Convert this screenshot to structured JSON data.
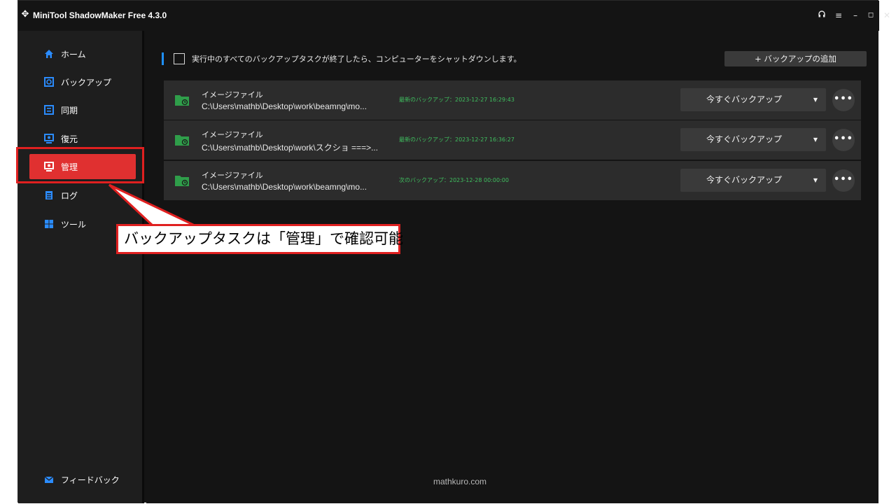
{
  "window": {
    "title": "MiniTool ShadowMaker Free 4.3.0",
    "controls": [
      "headset-icon",
      "menu-icon",
      "minimize-icon",
      "maximize-icon",
      "close-icon"
    ]
  },
  "sidebar": {
    "items": [
      {
        "label": "ホーム",
        "icon": "home-icon",
        "active": false
      },
      {
        "label": "バックアップ",
        "icon": "backup-icon",
        "active": false
      },
      {
        "label": "同期",
        "icon": "sync-icon",
        "active": false
      },
      {
        "label": "復元",
        "icon": "restore-icon",
        "active": false
      },
      {
        "label": "管理",
        "icon": "manage-icon",
        "active": true
      },
      {
        "label": "ログ",
        "icon": "log-icon",
        "active": false
      },
      {
        "label": "ツール",
        "icon": "tools-icon",
        "active": false
      }
    ],
    "feedback_label": "フィードバック"
  },
  "main": {
    "shutdown_label": "実行中のすべてのバックアップタスクが終了したら、コンピューターをシャットダウンします。",
    "add_backup_label": "+ バックアップの追加",
    "tasks": [
      {
        "name": "イメージファイル",
        "path": "C:\\Users\\mathb\\Desktop\\work\\beamng\\mo...",
        "status": "最新のバックアップ：2023-12-27 16:29:43",
        "button": "今すぐバックアップ"
      },
      {
        "name": "イメージファイル",
        "path": "C:\\Users\\mathb\\Desktop\\work\\スクショ ===>...",
        "status": "最新のバックアップ：2023-12-27 16:36:27",
        "button": "今すぐバックアップ"
      },
      {
        "name": "イメージファイル",
        "path": "C:\\Users\\mathb\\Desktop\\work\\beamng\\mo...",
        "status": "次のバックアップ：2023-12-28 00:00:00",
        "button": "今すぐバックアップ"
      }
    ],
    "watermark": "mathkuro.com"
  },
  "callout": {
    "text": "バックアップタスクは「管理」で確認可能"
  },
  "colors": {
    "accent": "#1e90ff",
    "active_nav": "#e03030",
    "status_green": "#3fbf5f",
    "callout_red": "#e02020"
  }
}
